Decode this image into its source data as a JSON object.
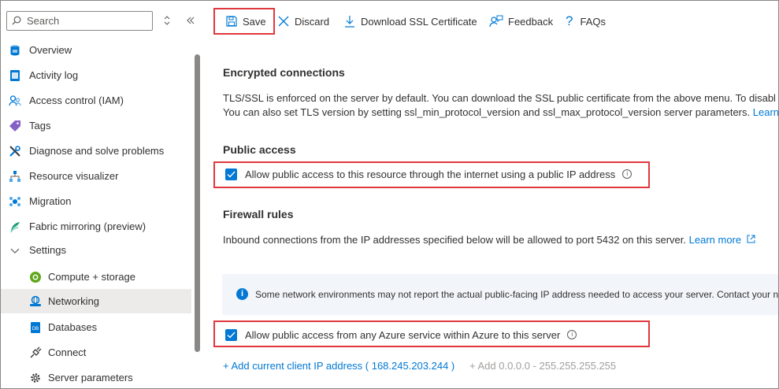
{
  "sidebar": {
    "search_placeholder": "Search",
    "items": [
      {
        "label": "Overview",
        "icon": "overview-icon"
      },
      {
        "label": "Activity log",
        "icon": "activity-log-icon"
      },
      {
        "label": "Access control (IAM)",
        "icon": "iam-icon"
      },
      {
        "label": "Tags",
        "icon": "tag-icon"
      },
      {
        "label": "Diagnose and solve problems",
        "icon": "wrench-icon"
      },
      {
        "label": "Resource visualizer",
        "icon": "hierarchy-icon"
      },
      {
        "label": "Migration",
        "icon": "migration-icon"
      },
      {
        "label": "Fabric mirroring (preview)",
        "icon": "fabric-icon"
      },
      {
        "label": "Settings",
        "icon": "chevron-down-icon"
      },
      {
        "label": "Compute + storage",
        "icon": "compute-icon"
      },
      {
        "label": "Networking",
        "icon": "networking-icon",
        "selected": true
      },
      {
        "label": "Databases",
        "icon": "database-icon"
      },
      {
        "label": "Connect",
        "icon": "plug-icon"
      },
      {
        "label": "Server parameters",
        "icon": "gear-icon"
      }
    ]
  },
  "toolbar": {
    "save": "Save",
    "discard": "Discard",
    "download": "Download SSL Certificate",
    "feedback": "Feedback",
    "faqs": "FAQs"
  },
  "content": {
    "encrypted_heading": "Encrypted connections",
    "encrypted_line1": "TLS/SSL is enforced on the server by default. You can download the SSL public certificate from the above menu. To disabl",
    "encrypted_line2": "You can also set TLS version by setting ssl_min_protocol_version and ssl_max_protocol_version server parameters.",
    "encrypted_line2_link": "Learn m",
    "public_heading": "Public access",
    "public_checkbox": "Allow public access to this resource through the internet using a public IP address",
    "public_checked": true,
    "firewall_heading": "Firewall rules",
    "firewall_text": "Inbound connections from the IP addresses specified below will be allowed to port 5432 on this server.",
    "firewall_link": "Learn more",
    "banner_text": "Some network environments may not report the actual public-facing IP address needed to access your server.  Contact your ne",
    "azure_checkbox": "Allow public access from any Azure service within Azure to this server",
    "azure_checked": true,
    "add_client_ip": "+ Add current client IP address ( 168.245.203.244 )",
    "add_range": "+ Add 0.0.0.0 - 255.255.255.255"
  },
  "colors": {
    "accent": "#0078d4",
    "highlight": "#e0383e",
    "selected_bg": "#edebe9"
  }
}
